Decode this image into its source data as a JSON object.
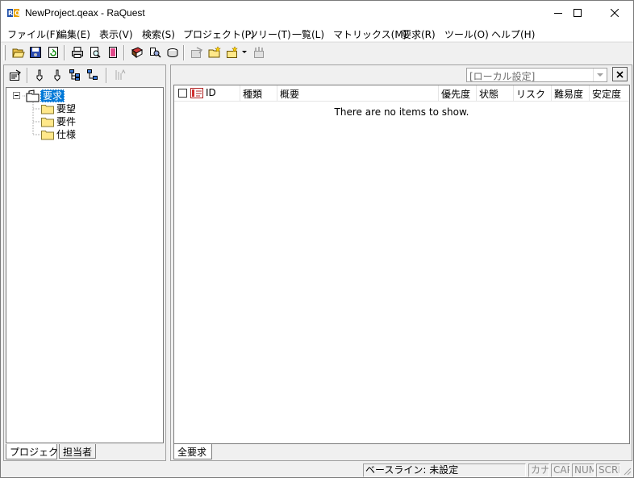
{
  "window": {
    "title": "NewProject.qeax - RaQuest"
  },
  "menu": {
    "items": [
      "ファイル(F)",
      "編集(E)",
      "表示(V)",
      "検索(S)",
      "プロジェクト(P)",
      "ツリー(T)",
      "一覧(L)",
      "マトリックス(M)",
      "要求(R)",
      "ツール(O)",
      "ヘルプ(H)"
    ]
  },
  "tree": {
    "root": "要求",
    "children": [
      "要望",
      "要件",
      "仕様"
    ]
  },
  "left_tabs": [
    "プロジェクト",
    "担当者"
  ],
  "view_combo": {
    "value": "[ローカル設定]"
  },
  "list": {
    "columns": [
      "ID",
      "種類",
      "概要",
      "優先度",
      "状態",
      "リスク",
      "難易度",
      "安定度"
    ],
    "empty_message": "There are no items to show."
  },
  "right_tabs": [
    "全要求"
  ],
  "status": {
    "baseline": "ベースライン: 未設定",
    "kana": "カナ",
    "cap": "CAP",
    "num": "NUM",
    "scrl": "SCRL"
  },
  "colors": {
    "selection": "#0078d7",
    "folder": "#ffe88a",
    "window_bg": "#f0f0f0"
  }
}
